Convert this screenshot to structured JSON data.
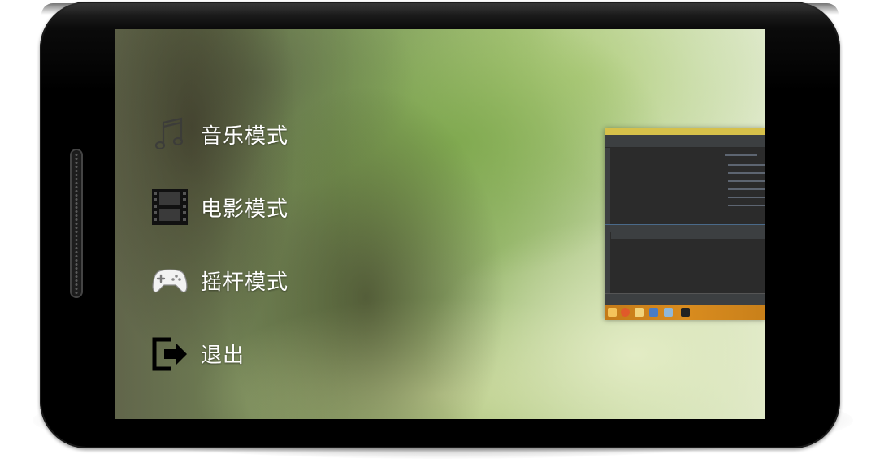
{
  "menu": {
    "items": [
      {
        "label": "音乐模式",
        "icon": "music-notes-icon"
      },
      {
        "label": "电影模式",
        "icon": "film-strip-icon"
      },
      {
        "label": "摇杆模式",
        "icon": "gamepad-icon"
      },
      {
        "label": "退出",
        "icon": "exit-icon"
      }
    ]
  },
  "colors": {
    "label_text": "#ffffff",
    "phone_body": "#000000",
    "taskbar": "#d98c1f",
    "ide_background": "#2b2b2b"
  }
}
